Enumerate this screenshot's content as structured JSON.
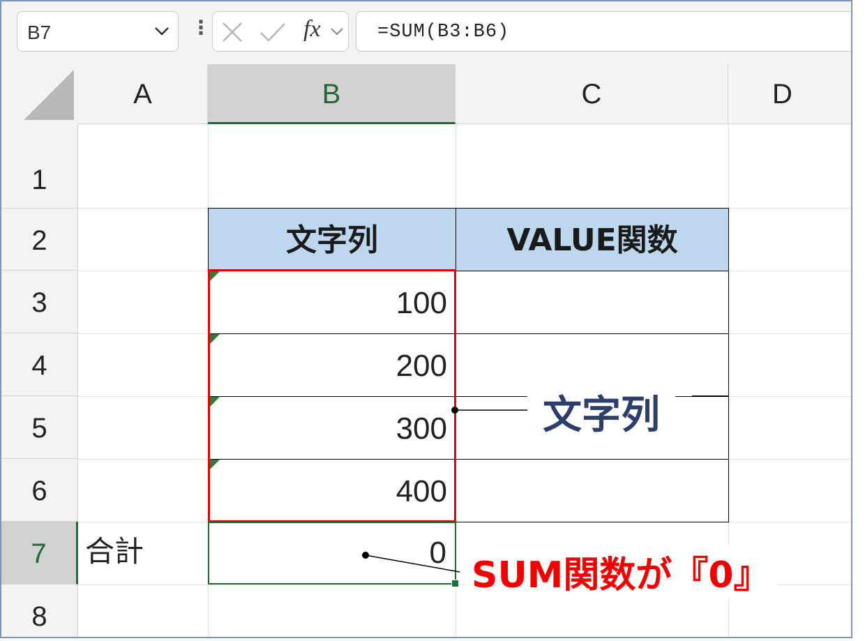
{
  "formula_bar": {
    "name_box": "B7",
    "chevron": "⌄",
    "fx_label": "fx",
    "formula": "=SUM(B3:B6)"
  },
  "columns": [
    "A",
    "B",
    "C",
    "D"
  ],
  "rows": [
    "1",
    "2",
    "3",
    "4",
    "5",
    "6",
    "7",
    "8"
  ],
  "cells": {
    "B2": "文字列",
    "C2": "VALUE関数",
    "B3": "100",
    "B4": "200",
    "B5": "300",
    "B6": "400",
    "A7": "合計",
    "B7": "0"
  },
  "annotations": {
    "text_label": "文字列",
    "sum_label": "SUM関数が『0』"
  },
  "colors": {
    "header_fill": "#bdd7ee",
    "selection_green": "#1e6b34",
    "text_warning_triangle": "#2e7d32",
    "highlight_red": "#e00000",
    "annotation_blue": "#2e3e6b",
    "annotation_red": "#f00000"
  },
  "icons": {
    "cancel": "x-icon",
    "enter": "check-icon",
    "more": "kebab-icon"
  }
}
